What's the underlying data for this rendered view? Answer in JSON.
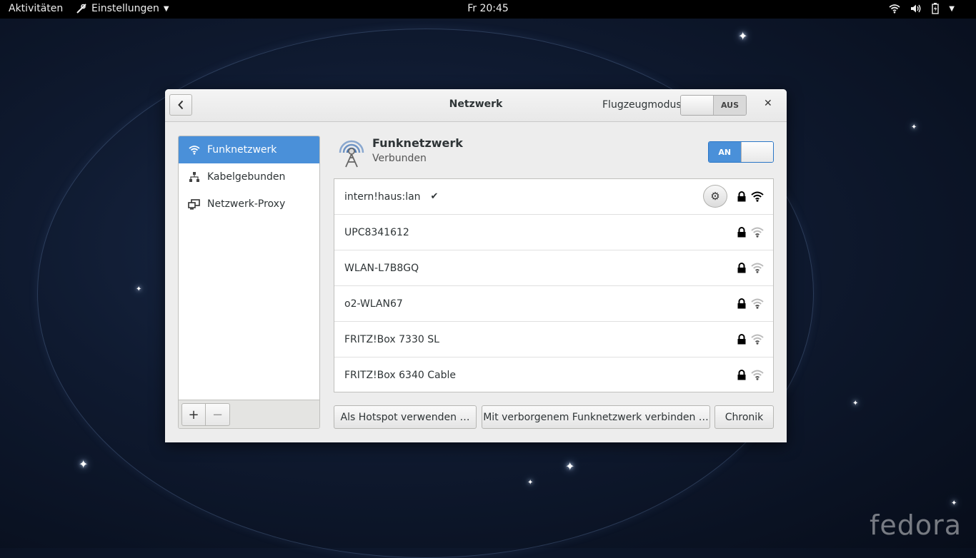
{
  "topbar": {
    "activities": "Aktivitäten",
    "app_menu": "Einstellungen",
    "app_menu_icon": "wrench-screwdriver-icon",
    "clock": "Fr 20:45",
    "status_icons": [
      "wifi-icon",
      "volume-icon",
      "battery-icon",
      "power-icon"
    ]
  },
  "window": {
    "title": "Netzwerk",
    "airplane_mode_label": "Flugzeugmodus",
    "airplane_mode_state": "AUS"
  },
  "sidebar": {
    "items": [
      {
        "label": "Funknetzwerk",
        "icon": "wifi-icon",
        "active": true
      },
      {
        "label": "Kabelgebunden",
        "icon": "wired-network-icon",
        "active": false
      },
      {
        "label": "Netzwerk-Proxy",
        "icon": "proxy-icon",
        "active": false
      }
    ],
    "add_label": "+",
    "remove_label": "−"
  },
  "wifi": {
    "title": "Funknetzwerk",
    "status": "Verbunden",
    "switch_state": "AN"
  },
  "networks": [
    {
      "name": "intern!haus:lan",
      "connected": true,
      "check": "✔",
      "secured": true,
      "signal": "strong"
    },
    {
      "name": "UPC8341612",
      "connected": false,
      "secured": true,
      "signal": "weak"
    },
    {
      "name": "WLAN-L7B8GQ",
      "connected": false,
      "secured": true,
      "signal": "weak"
    },
    {
      "name": "o2-WLAN67",
      "connected": false,
      "secured": true,
      "signal": "weak"
    },
    {
      "name": "FRITZ!Box 7330 SL",
      "connected": false,
      "secured": true,
      "signal": "weak"
    },
    {
      "name": "FRITZ!Box 6340 Cable",
      "connected": false,
      "secured": true,
      "signal": "weak"
    }
  ],
  "buttons": {
    "hotspot": "Als Hotspot verwenden …",
    "hidden": "Mit verborgenem Funknetzwerk verbinden …",
    "history": "Chronik"
  },
  "desktop": {
    "logo_text": "fedora"
  },
  "colors": {
    "accent": "#4a90d9",
    "topbar": "#000000",
    "window_bg": "#ededed"
  }
}
